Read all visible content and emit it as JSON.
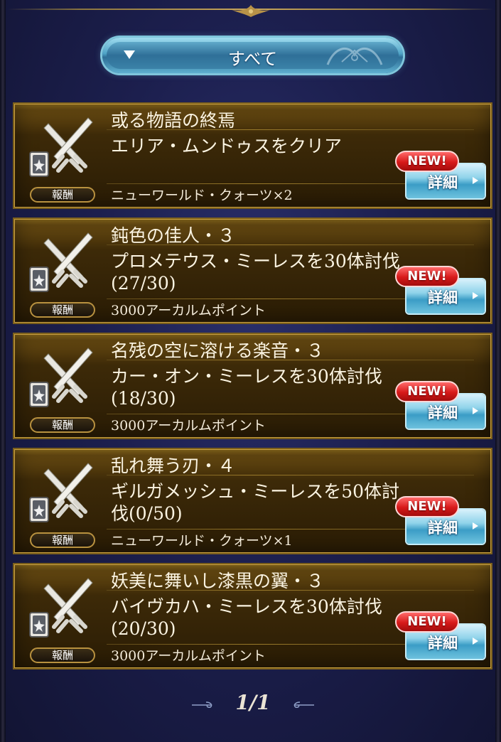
{
  "filter": {
    "label": "すべて"
  },
  "quests": [
    {
      "title": "或る物語の終焉",
      "desc": "エリア・ムンドゥスをクリア",
      "reward_label": "報酬",
      "reward": "ニューワールド・クォーツ×2",
      "badge": "NEW!",
      "detail": "詳細"
    },
    {
      "title": "鈍色の佳人・３",
      "desc": "プロメテウス・ミーレスを30体討伐(27/30)",
      "reward_label": "報酬",
      "reward": "3000アーカルムポイント",
      "badge": "NEW!",
      "detail": "詳細"
    },
    {
      "title": "名残の空に溶ける楽音・３",
      "desc": "カー・オン・ミーレスを30体討伐(18/30)",
      "reward_label": "報酬",
      "reward": "3000アーカルムポイント",
      "badge": "NEW!",
      "detail": "詳細"
    },
    {
      "title": "乱れ舞う刃・４",
      "desc": "ギルガメッシュ・ミーレスを50体討伐(0/50)",
      "reward_label": "報酬",
      "reward": "ニューワールド・クォーツ×1",
      "badge": "NEW!",
      "detail": "詳細"
    },
    {
      "title": "妖美に舞いし漆黒の翼・３",
      "desc": "バイヴカハ・ミーレスを30体討伐(20/30)",
      "reward_label": "報酬",
      "reward": "3000アーカルムポイント",
      "badge": "NEW!",
      "detail": "詳細"
    }
  ],
  "pager": {
    "text": "1/1"
  },
  "icons": {
    "quest": "crossed-swords-card-icon",
    "filter_toggle": "triangle-down-icon",
    "detail_arrow": "play-arrow-icon"
  }
}
